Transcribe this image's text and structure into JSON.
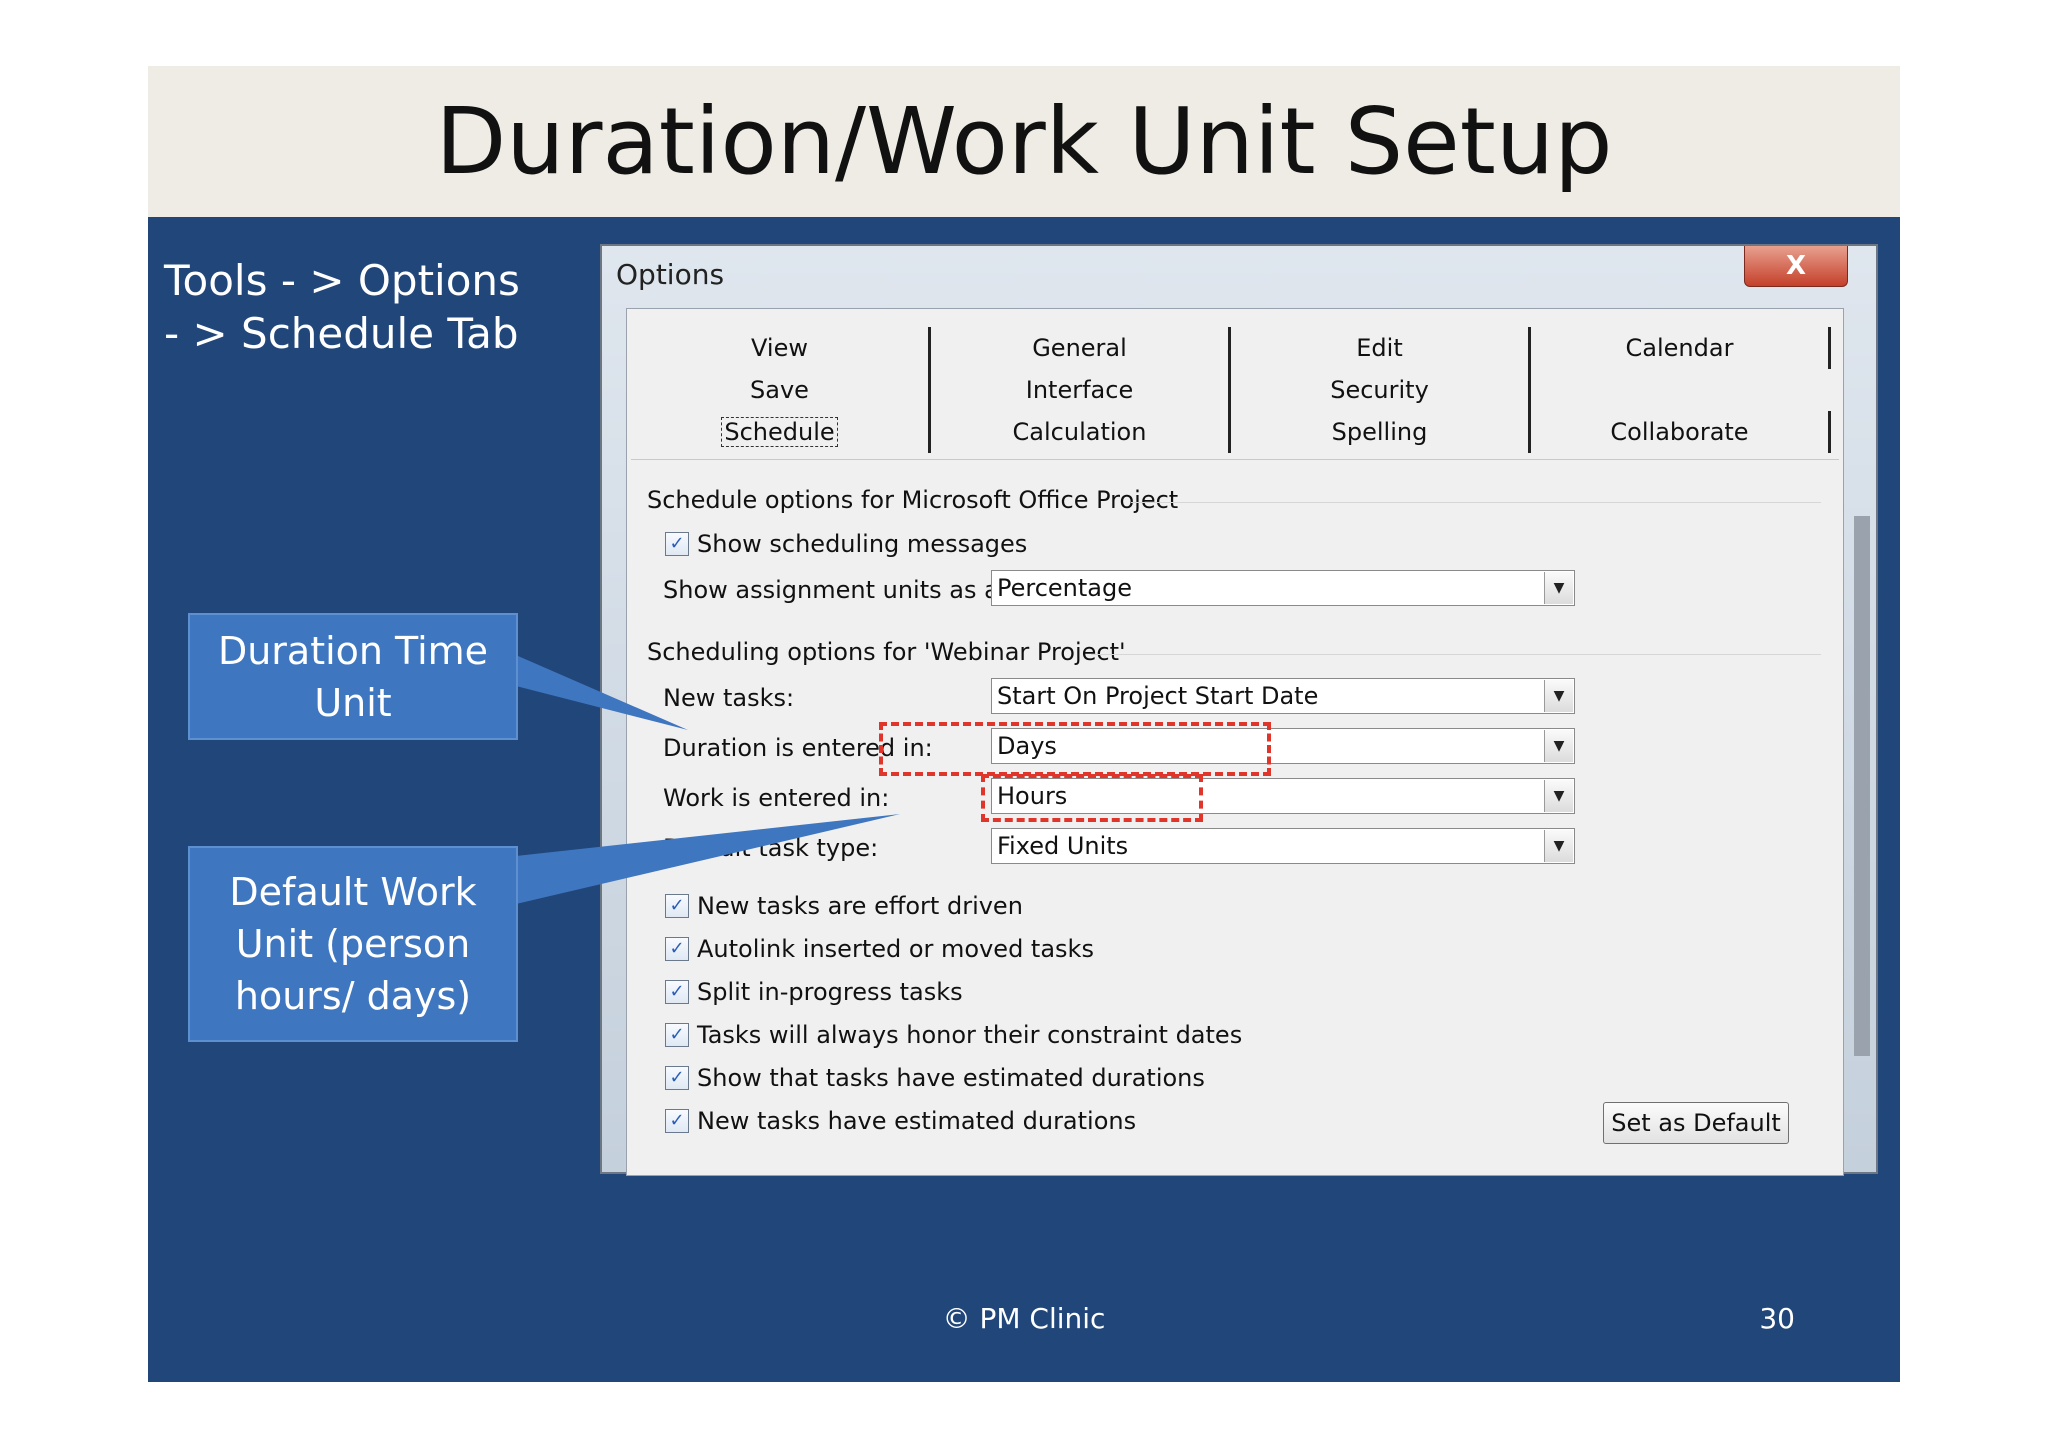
{
  "slide": {
    "title": "Duration/Work Unit Setup",
    "path_line1": "Tools - > Options",
    "path_line2": "- > Schedule Tab",
    "callout_duration": [
      "Duration Time",
      "Unit"
    ],
    "callout_work": [
      "Default Work",
      "Unit (person",
      "hours/ days)"
    ],
    "footer": "© PM Clinic",
    "page_number": "30"
  },
  "dialog": {
    "title": "Options",
    "close_label": "X",
    "tabs": [
      [
        "View",
        "General",
        "Edit",
        "Calendar"
      ],
      [
        "Save",
        "Interface",
        "Security",
        ""
      ],
      [
        "Schedule",
        "Calculation",
        "Spelling",
        "Collaborate"
      ]
    ],
    "active_tab": "Schedule",
    "section1": "Schedule options for Microsoft Office Project",
    "show_scheduling_messages": "Show scheduling messages",
    "assignment_units_label": "Show assignment units as a:",
    "assignment_units_value": "Percentage",
    "section2": "Scheduling options for 'Webinar Project'",
    "new_tasks_label": "New tasks:",
    "new_tasks_value": "Start On Project Start Date",
    "duration_label": "Duration is entered in:",
    "duration_value": "Days",
    "work_label": "Work is entered in:",
    "work_value": "Hours",
    "task_type_label": "Default task type:",
    "task_type_value": "Fixed Units",
    "checkboxes": [
      "New tasks are effort driven",
      "Autolink inserted or moved tasks",
      "Split in-progress tasks",
      "Tasks will always honor their constraint dates",
      "Show that tasks have estimated durations",
      "New tasks have estimated durations"
    ],
    "set_default_button": "Set as Default"
  },
  "colors": {
    "slide_background": "#21467a",
    "title_band": "#eeece4",
    "callout": "#3f76c0",
    "highlight": "#e0352a"
  }
}
